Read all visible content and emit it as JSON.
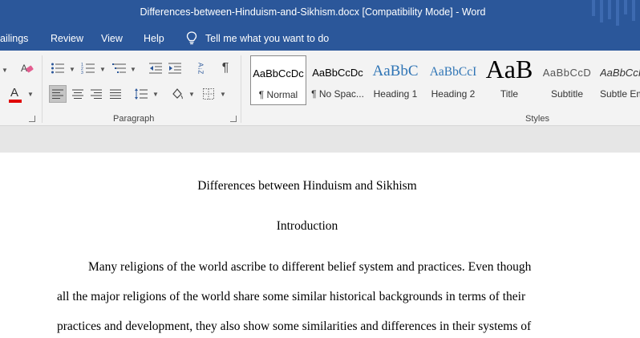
{
  "window": {
    "title": "Differences-between-Hinduism-and-Sikhism.docx [Compatibility Mode]  -  Word"
  },
  "tabs": {
    "mailings": "ailings",
    "review": "Review",
    "view": "View",
    "help": "Help",
    "tell_me": "Tell me what you want to do"
  },
  "ribbon": {
    "paragraph_label": "Paragraph",
    "styles_label": "Styles",
    "pilcrow": "¶",
    "font_color_letter": "A",
    "sort_glyph": "A↓Z"
  },
  "styles": [
    {
      "sample": "AaBbCcDc",
      "name": "¶ Normal"
    },
    {
      "sample": "AaBbCcDc",
      "name": "¶ No Spac..."
    },
    {
      "sample": "AaBbC",
      "name": "Heading 1"
    },
    {
      "sample": "AaBbCcI",
      "name": "Heading 2"
    },
    {
      "sample": "AaB",
      "name": "Title"
    },
    {
      "sample": "AaBbCcD",
      "name": "Subtitle"
    },
    {
      "sample": "AaBbCcI",
      "name": "Subtle Em"
    }
  ],
  "document": {
    "title": "Differences between Hinduism and Sikhism",
    "heading": "Introduction",
    "lines": [
      "Many religions of the world ascribe to different belief system and practices. Even though",
      "all the major religions of the world share some similar historical backgrounds in terms of their",
      "practices and development, they also show some similarities and differences in their systems of"
    ]
  },
  "colors": {
    "accent": "#2b579a",
    "ribbon_bg": "#f3f3f3",
    "heading_blue": "#2e74b5",
    "font_color_red": "#e00000"
  }
}
